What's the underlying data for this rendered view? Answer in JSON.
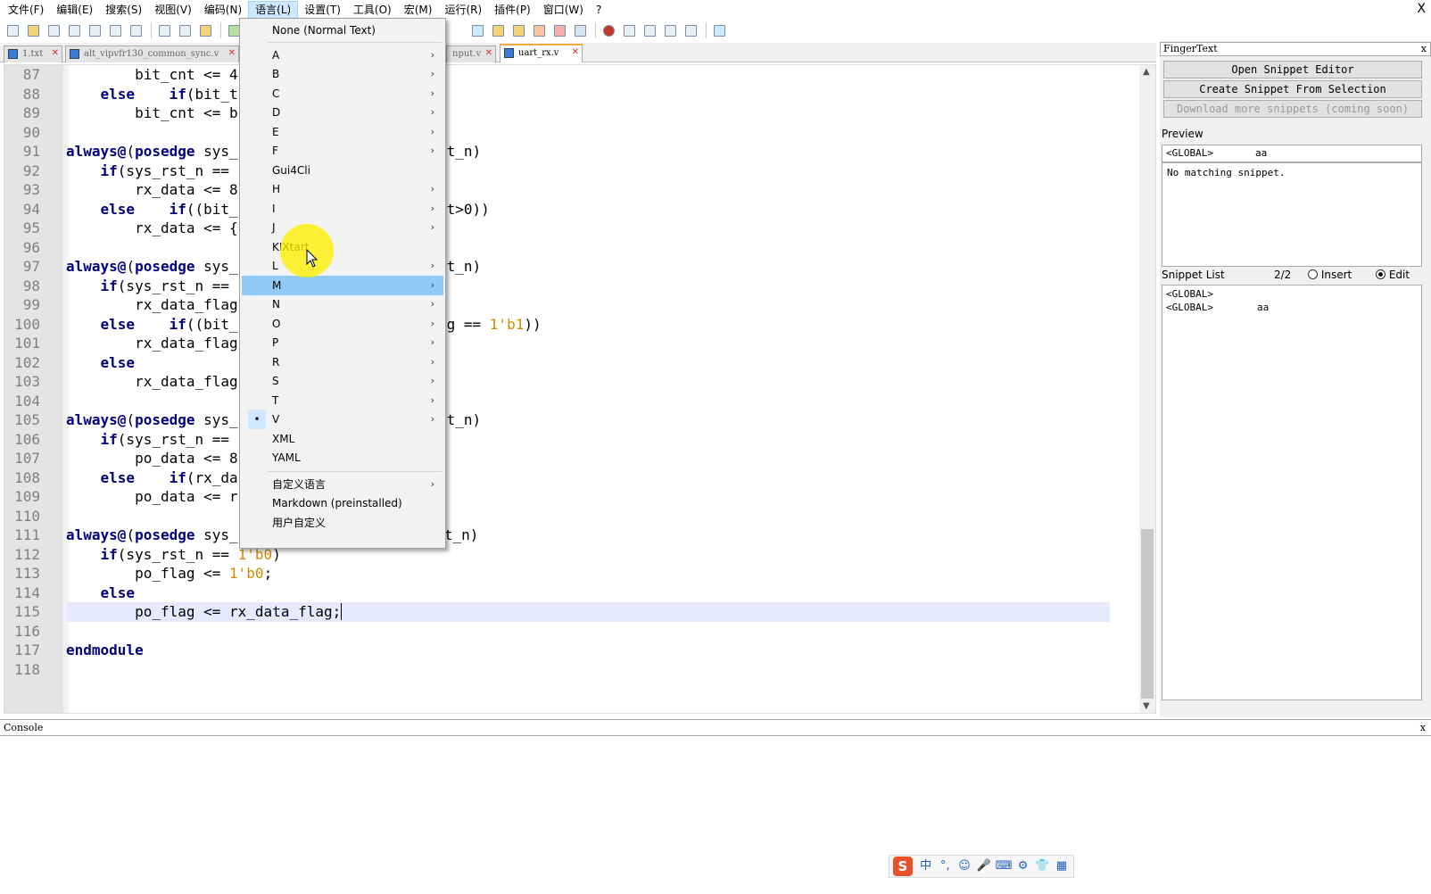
{
  "menubar": {
    "items": [
      "文件(F)",
      "编辑(E)",
      "搜索(S)",
      "视图(V)",
      "编码(N)",
      "语言(L)",
      "设置(T)",
      "工具(O)",
      "宏(M)",
      "运行(R)",
      "插件(P)",
      "窗口(W)",
      "?"
    ],
    "close": "X"
  },
  "tabs": [
    {
      "label": "1.txt"
    },
    {
      "label": "alt_vipvfr130_common_sync.v"
    },
    {
      "label": "nput.v"
    },
    {
      "label": "uart_rx.v"
    }
  ],
  "editor": {
    "lines": [
      {
        "n": "87",
        "code": "        bit_cnt <= 4"
      },
      {
        "n": "88",
        "code": "    else    if(bit_t"
      },
      {
        "n": "89",
        "code": "        bit_cnt <= b"
      },
      {
        "n": "90",
        "code": ""
      },
      {
        "n": "91",
        "code": "always@(posedge sys_",
        "tail": "st_n)"
      },
      {
        "n": "92",
        "code": "    if(sys_rst_n =="
      },
      {
        "n": "93",
        "code": "        rx_data <= 8"
      },
      {
        "n": "94",
        "code": "    else    if((bit_",
        "tail": "nt>0))"
      },
      {
        "n": "95",
        "code": "        rx_data <= {"
      },
      {
        "n": "96",
        "code": ""
      },
      {
        "n": "97",
        "code": "always@(posedge sys_",
        "tail": "st_n)"
      },
      {
        "n": "98",
        "code": "    if(sys_rst_n =="
      },
      {
        "n": "99",
        "code": "        rx_data_flag"
      },
      {
        "n": "100",
        "code": "    else    if((bit_",
        "tail": "ag == 1'b1))"
      },
      {
        "n": "101",
        "code": "        rx_data_flag"
      },
      {
        "n": "102",
        "code": "    else"
      },
      {
        "n": "103",
        "code": "        rx_data_flag"
      },
      {
        "n": "104",
        "code": ""
      },
      {
        "n": "105",
        "code": "always@(posedge sys_",
        "tail": "st_n)"
      },
      {
        "n": "106",
        "code": "    if(sys_rst_n =="
      },
      {
        "n": "107",
        "code": "        po_data <= 8"
      },
      {
        "n": "108",
        "code": "    else    if(rx_da"
      },
      {
        "n": "109",
        "code": "        po_data <= r"
      },
      {
        "n": "110",
        "code": ""
      },
      {
        "n": "111",
        "code": "always@(posedge sys_clk  or  negedge  sys_rst_n)"
      },
      {
        "n": "112",
        "code": "    if(sys_rst_n == 1'b0)"
      },
      {
        "n": "113",
        "code": "        po_flag <= 1'b0;"
      },
      {
        "n": "114",
        "code": "    else"
      },
      {
        "n": "115",
        "code": "        po_flag <= rx_data_flag;"
      },
      {
        "n": "116",
        "code": ""
      },
      {
        "n": "117",
        "code": "endmodule"
      },
      {
        "n": "118",
        "code": ""
      }
    ]
  },
  "dropdown": {
    "items": [
      {
        "label": "None (Normal Text)",
        "sub": false
      },
      {
        "label": "A",
        "sub": true
      },
      {
        "label": "B",
        "sub": true
      },
      {
        "label": "C",
        "sub": true
      },
      {
        "label": "D",
        "sub": true
      },
      {
        "label": "E",
        "sub": true
      },
      {
        "label": "F",
        "sub": true
      },
      {
        "label": "Gui4Cli",
        "sub": false
      },
      {
        "label": "H",
        "sub": true
      },
      {
        "label": "I",
        "sub": true
      },
      {
        "label": "J",
        "sub": true
      },
      {
        "label": "KIXtart",
        "sub": false
      },
      {
        "label": "L",
        "sub": true
      },
      {
        "label": "M",
        "sub": true,
        "highlighted": true
      },
      {
        "label": "N",
        "sub": true
      },
      {
        "label": "O",
        "sub": true
      },
      {
        "label": "P",
        "sub": true
      },
      {
        "label": "R",
        "sub": true
      },
      {
        "label": "S",
        "sub": true
      },
      {
        "label": "T",
        "sub": true
      },
      {
        "label": "V",
        "sub": true,
        "checked": true
      },
      {
        "label": "XML",
        "sub": false
      },
      {
        "label": "YAML",
        "sub": false
      },
      {
        "label": "自定义语言",
        "sub": true
      },
      {
        "label": "Markdown (preinstalled)",
        "sub": false
      },
      {
        "label": "用户自定义",
        "sub": false
      }
    ]
  },
  "panel": {
    "title": "FingerText",
    "close": "x",
    "btn_open": "Open Snippet Editor",
    "btn_create": "Create Snippet From Selection",
    "btn_download": "Download more snippets (coming soon)",
    "preview_label": "Preview",
    "preview_scope": "<GLOBAL>",
    "preview_name": "aa",
    "preview_body": "No matching snippet.",
    "snippet_list_label": "Snippet List",
    "snippet_count": "2/2",
    "radio_insert": "Insert",
    "radio_edit": "Edit",
    "snippets": [
      {
        "scope": "<GLOBAL>",
        "name": ""
      },
      {
        "scope": "<GLOBAL>",
        "name": "aa"
      }
    ]
  },
  "console": {
    "title": "Console",
    "close": "x"
  },
  "ime": {
    "logo": "S",
    "items": [
      "中",
      "°,",
      "☺",
      "🎤",
      "⌨",
      "⚙",
      "👕",
      "▦"
    ]
  }
}
